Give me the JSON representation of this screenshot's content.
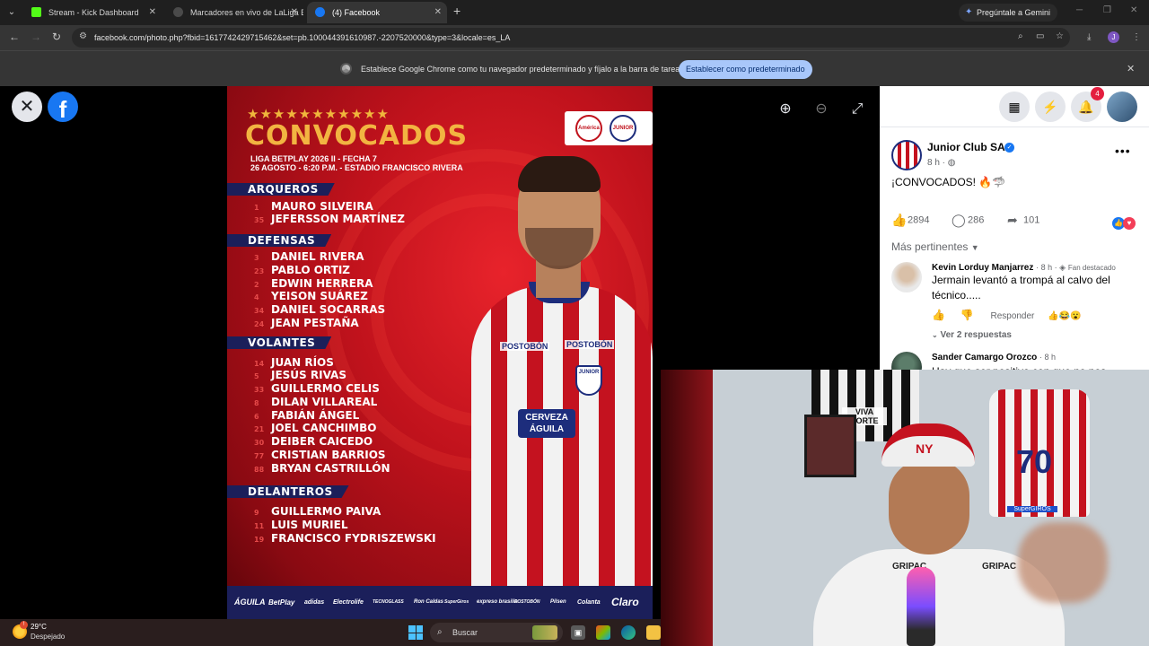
{
  "browser": {
    "tabs": [
      {
        "title": "Stream - Kick Dashboard",
        "favicon_color": "#53fc18",
        "active": false
      },
      {
        "title": "Marcadores en vivo de LaLiga E",
        "favicon_color": "#4a4a4a",
        "active": false
      },
      {
        "title": "(4) Facebook",
        "favicon_color": "#1877f2",
        "active": true
      }
    ],
    "gemini_label": "Pregúntale a Gemini",
    "url": "facebook.com/photo.php?fbid=1617742429715462&set=pb.100044391610987.-2207520000&type=3&locale=es_LA",
    "profile_initial": "J",
    "infobar": {
      "message": "Establece Google Chrome como tu navegador predeterminado y fíjalo a la barra de tareas",
      "button": "Establecer como predeterminado"
    }
  },
  "poster": {
    "stars": "★★★★★★★★★★★",
    "title": "CONVOCADOS",
    "subtitle1": "LIGA BETPLAY 2026 II - FECHA 7",
    "subtitle2": "26 AGOSTO - 6:20 P.M. - ESTADIO FRANCISCO RIVERA",
    "badge_left": "América",
    "badge_right": "JUNIOR",
    "sections": [
      {
        "name": "ARQUEROS",
        "players": [
          {
            "num": "1",
            "name": "MAURO SILVEIRA"
          },
          {
            "num": "35",
            "name": "JEFERSSON MARTÍNEZ"
          }
        ]
      },
      {
        "name": "DEFENSAS",
        "players": [
          {
            "num": "3",
            "name": "DANIEL RIVERA"
          },
          {
            "num": "23",
            "name": "PABLO ORTIZ"
          },
          {
            "num": "2",
            "name": "EDWIN HERRERA"
          },
          {
            "num": "4",
            "name": "YEISON SUÁREZ"
          },
          {
            "num": "34",
            "name": "DANIEL SOCARRAS"
          },
          {
            "num": "24",
            "name": "JEAN PESTAÑA"
          }
        ]
      },
      {
        "name": "VOLANTES",
        "players": [
          {
            "num": "14",
            "name": "JUAN RÍOS"
          },
          {
            "num": "5",
            "name": "JESÚS RIVAS"
          },
          {
            "num": "33",
            "name": "GUILLERMO CELIS"
          },
          {
            "num": "8",
            "name": "DILAN VILLAREAL"
          },
          {
            "num": "6",
            "name": "FABIÁN ÁNGEL"
          },
          {
            "num": "21",
            "name": "JOEL CANCHIMBO"
          },
          {
            "num": "30",
            "name": "DEIBER CAICEDO"
          },
          {
            "num": "77",
            "name": "CRISTIAN BARRIOS"
          },
          {
            "num": "88",
            "name": "BRYAN CASTRILLÓN"
          }
        ]
      },
      {
        "name": "DELANTEROS",
        "players": [
          {
            "num": "9",
            "name": "GUILLERMO PAIVA"
          },
          {
            "num": "11",
            "name": "LUIS MURIEL"
          },
          {
            "num": "19",
            "name": "FRANCISCO FYDRISZEWSKI"
          }
        ]
      }
    ],
    "shirt_sponsor_1": "POSTOBÓN",
    "shirt_sponsor_2": "POSTOBÓN",
    "shirt_badge": "JUNIOR",
    "shirt_sponsor_3": "CERVEZA ÁGUILA",
    "sponsors": [
      "ÁGUILA",
      "BetPlay",
      "adidas",
      "Electrolife",
      "TECNOGLASS",
      "Ron Caldas",
      "SuperGiros",
      "expreso brasilia",
      "POSTOBÓN",
      "Pilsen",
      "Colanta",
      "Claro"
    ]
  },
  "facebook": {
    "notifications": "4",
    "page_name": "Junior Club SA",
    "post_time": "8 h · ",
    "post_text": "¡CONVOCADOS! 🔥🦈",
    "likes": "2894",
    "comments": "286",
    "shares": "101",
    "relevance": "Más pertinentes",
    "comments_list": [
      {
        "author": "Kevin Lorduy Manjarrez",
        "meta": "· 8 h · ",
        "badge": "Fan destacado",
        "text": "Jermain levantó a trompá al calvo del técnico.....",
        "reply": "Responder",
        "view_replies": "Ver 2 respuestas"
      },
      {
        "author": "Sander Camargo Orozco",
        "meta": "· 8 h",
        "text": "Hay que ser positivo con que no nos"
      }
    ]
  },
  "webcam": {
    "jersey_text": "VIVA SORTE",
    "jersey_number": "70",
    "jersey_sponsor": "SuperGIROS",
    "cap_logo": "NY",
    "shirt_left": "GRIPAC",
    "shirt_right": "GRIPAC"
  },
  "taskbar": {
    "temperature": "29°C",
    "condition": "Despejado",
    "search": "Buscar"
  }
}
